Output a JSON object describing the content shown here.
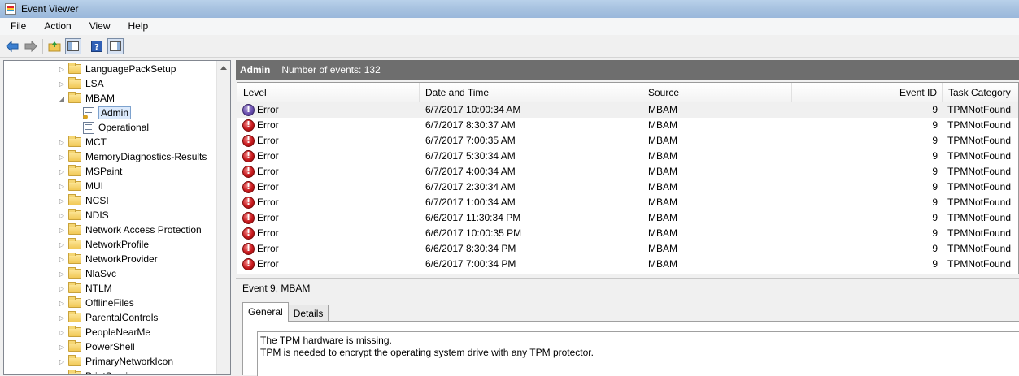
{
  "window": {
    "title": "Event Viewer"
  },
  "menu": [
    "File",
    "Action",
    "View",
    "Help"
  ],
  "toolbar": {
    "buttons": [
      "back-arrow-icon",
      "forward-arrow-icon",
      "up-folder-icon",
      "show-hide-tree-icon",
      "help-icon",
      "action-pane-icon"
    ]
  },
  "tree": {
    "items": [
      {
        "label": "LanguagePackSetup",
        "type": "folder",
        "expander": "▷"
      },
      {
        "label": "LSA",
        "type": "folder",
        "expander": "▷"
      },
      {
        "label": "MBAM",
        "type": "folder",
        "expander": "◢"
      },
      {
        "label": "Admin",
        "type": "log",
        "expander": "",
        "selected": true
      },
      {
        "label": "Operational",
        "type": "log",
        "expander": ""
      },
      {
        "label": "MCT",
        "type": "folder",
        "expander": "▷"
      },
      {
        "label": "MemoryDiagnostics-Results",
        "type": "folder",
        "expander": "▷"
      },
      {
        "label": "MSPaint",
        "type": "folder",
        "expander": "▷"
      },
      {
        "label": "MUI",
        "type": "folder",
        "expander": "▷"
      },
      {
        "label": "NCSI",
        "type": "folder",
        "expander": "▷"
      },
      {
        "label": "NDIS",
        "type": "folder",
        "expander": "▷"
      },
      {
        "label": "Network Access Protection",
        "type": "folder",
        "expander": "▷"
      },
      {
        "label": "NetworkProfile",
        "type": "folder",
        "expander": "▷"
      },
      {
        "label": "NetworkProvider",
        "type": "folder",
        "expander": "▷"
      },
      {
        "label": "NlaSvc",
        "type": "folder",
        "expander": "▷"
      },
      {
        "label": "NTLM",
        "type": "folder",
        "expander": "▷"
      },
      {
        "label": "OfflineFiles",
        "type": "folder",
        "expander": "▷"
      },
      {
        "label": "ParentalControls",
        "type": "folder",
        "expander": "▷"
      },
      {
        "label": "PeopleNearMe",
        "type": "folder",
        "expander": "▷"
      },
      {
        "label": "PowerShell",
        "type": "folder",
        "expander": "▷"
      },
      {
        "label": "PrimaryNetworkIcon",
        "type": "folder",
        "expander": "▷"
      },
      {
        "label": "PrintService",
        "type": "folder",
        "expander": "▷"
      }
    ]
  },
  "list": {
    "title": "Admin",
    "count_text": "Number of events: 132",
    "columns": [
      "Level",
      "Date and Time",
      "Source",
      "Event ID",
      "Task Category"
    ],
    "rows": [
      {
        "level": "Error",
        "datetime": "6/7/2017 10:00:34 AM",
        "source": "MBAM",
        "event_id": "9",
        "task": "TPMNotFound"
      },
      {
        "level": "Error",
        "datetime": "6/7/2017 8:30:37 AM",
        "source": "MBAM",
        "event_id": "9",
        "task": "TPMNotFound"
      },
      {
        "level": "Error",
        "datetime": "6/7/2017 7:00:35 AM",
        "source": "MBAM",
        "event_id": "9",
        "task": "TPMNotFound"
      },
      {
        "level": "Error",
        "datetime": "6/7/2017 5:30:34 AM",
        "source": "MBAM",
        "event_id": "9",
        "task": "TPMNotFound"
      },
      {
        "level": "Error",
        "datetime": "6/7/2017 4:00:34 AM",
        "source": "MBAM",
        "event_id": "9",
        "task": "TPMNotFound"
      },
      {
        "level": "Error",
        "datetime": "6/7/2017 2:30:34 AM",
        "source": "MBAM",
        "event_id": "9",
        "task": "TPMNotFound"
      },
      {
        "level": "Error",
        "datetime": "6/7/2017 1:00:34 AM",
        "source": "MBAM",
        "event_id": "9",
        "task": "TPMNotFound"
      },
      {
        "level": "Error",
        "datetime": "6/6/2017 11:30:34 PM",
        "source": "MBAM",
        "event_id": "9",
        "task": "TPMNotFound"
      },
      {
        "level": "Error",
        "datetime": "6/6/2017 10:00:35 PM",
        "source": "MBAM",
        "event_id": "9",
        "task": "TPMNotFound"
      },
      {
        "level": "Error",
        "datetime": "6/6/2017 8:30:34 PM",
        "source": "MBAM",
        "event_id": "9",
        "task": "TPMNotFound"
      },
      {
        "level": "Error",
        "datetime": "6/6/2017 7:00:34 PM",
        "source": "MBAM",
        "event_id": "9",
        "task": "TPMNotFound"
      }
    ]
  },
  "detail": {
    "header": "Event 9, MBAM",
    "tabs": [
      "General",
      "Details"
    ],
    "description_lines": [
      "The TPM hardware is missing.",
      "TPM is needed to encrypt the operating system drive with any TPM protector."
    ]
  },
  "colors": {
    "list_header_bg": "#6e6e6e",
    "error_red": "#c8191d",
    "selection_blue": "#dceafc"
  }
}
